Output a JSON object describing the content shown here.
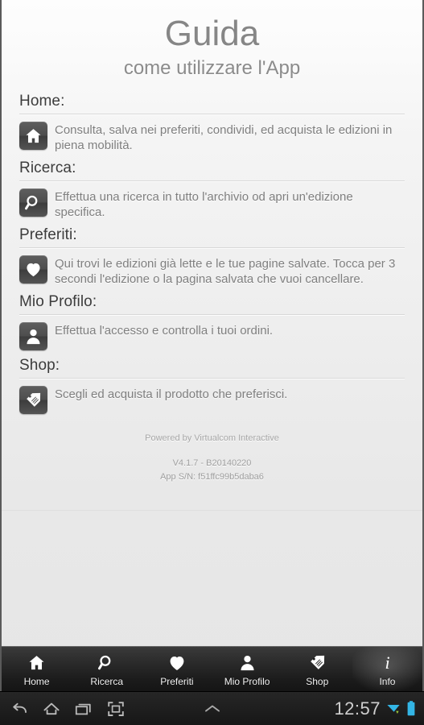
{
  "header": {
    "title": "Guida",
    "subtitle": "come utilizzare l'App"
  },
  "sections": [
    {
      "heading": "Home:",
      "icon": "home-icon",
      "text": "Consulta, salva nei preferiti, condividi, ed acquista le edizioni in piena mobilità."
    },
    {
      "heading": "Ricerca:",
      "icon": "search-icon",
      "text": "Effettua una ricerca in tutto l'archivio od apri un'edizione specifica."
    },
    {
      "heading": "Preferiti:",
      "icon": "heart-icon",
      "text": "Qui trovi le edizioni già lette e le tue pagine salvate. Tocca per 3 secondi l'edizione o la pagina salvata che vuoi cancellare."
    },
    {
      "heading": "Mio Profilo:",
      "icon": "person-icon",
      "text": "Effettua l'accesso e controlla i tuoi ordini."
    },
    {
      "heading": "Shop:",
      "icon": "tag-icon",
      "text": "Scegli ed acquista il prodotto che preferisci."
    }
  ],
  "footer": {
    "powered_by": "Powered by Virtualcom Interactive",
    "version": "V4.1.7 - B20140220",
    "serial": "App S/N: f51ffc99b5daba6"
  },
  "tabbar": {
    "items": [
      {
        "label": "Home",
        "icon": "home-icon",
        "active": false
      },
      {
        "label": "Ricerca",
        "icon": "search-icon",
        "active": false
      },
      {
        "label": "Preferiti",
        "icon": "heart-icon",
        "active": false
      },
      {
        "label": "Mio Profilo",
        "icon": "person-icon",
        "active": false
      },
      {
        "label": "Shop",
        "icon": "tag-icon",
        "active": false
      },
      {
        "label": "Info",
        "icon": "info-icon",
        "active": true
      }
    ]
  },
  "systembar": {
    "back": "back-icon",
    "home": "home-outline-icon",
    "recents": "recents-icon",
    "fullscreen": "fullscreen-icon",
    "expand": "chevron-up-icon",
    "clock": "12:57",
    "network": "wifi-download-icon",
    "battery": "battery-full-icon"
  },
  "colors": {
    "page_bg": "#ececec",
    "title": "#868686",
    "heading": "#3c3c3c",
    "body": "#7f7f7f",
    "tile": "#4e4e4e",
    "tabbar": "#2b2b2b",
    "status_accent": "#33b5e5"
  }
}
